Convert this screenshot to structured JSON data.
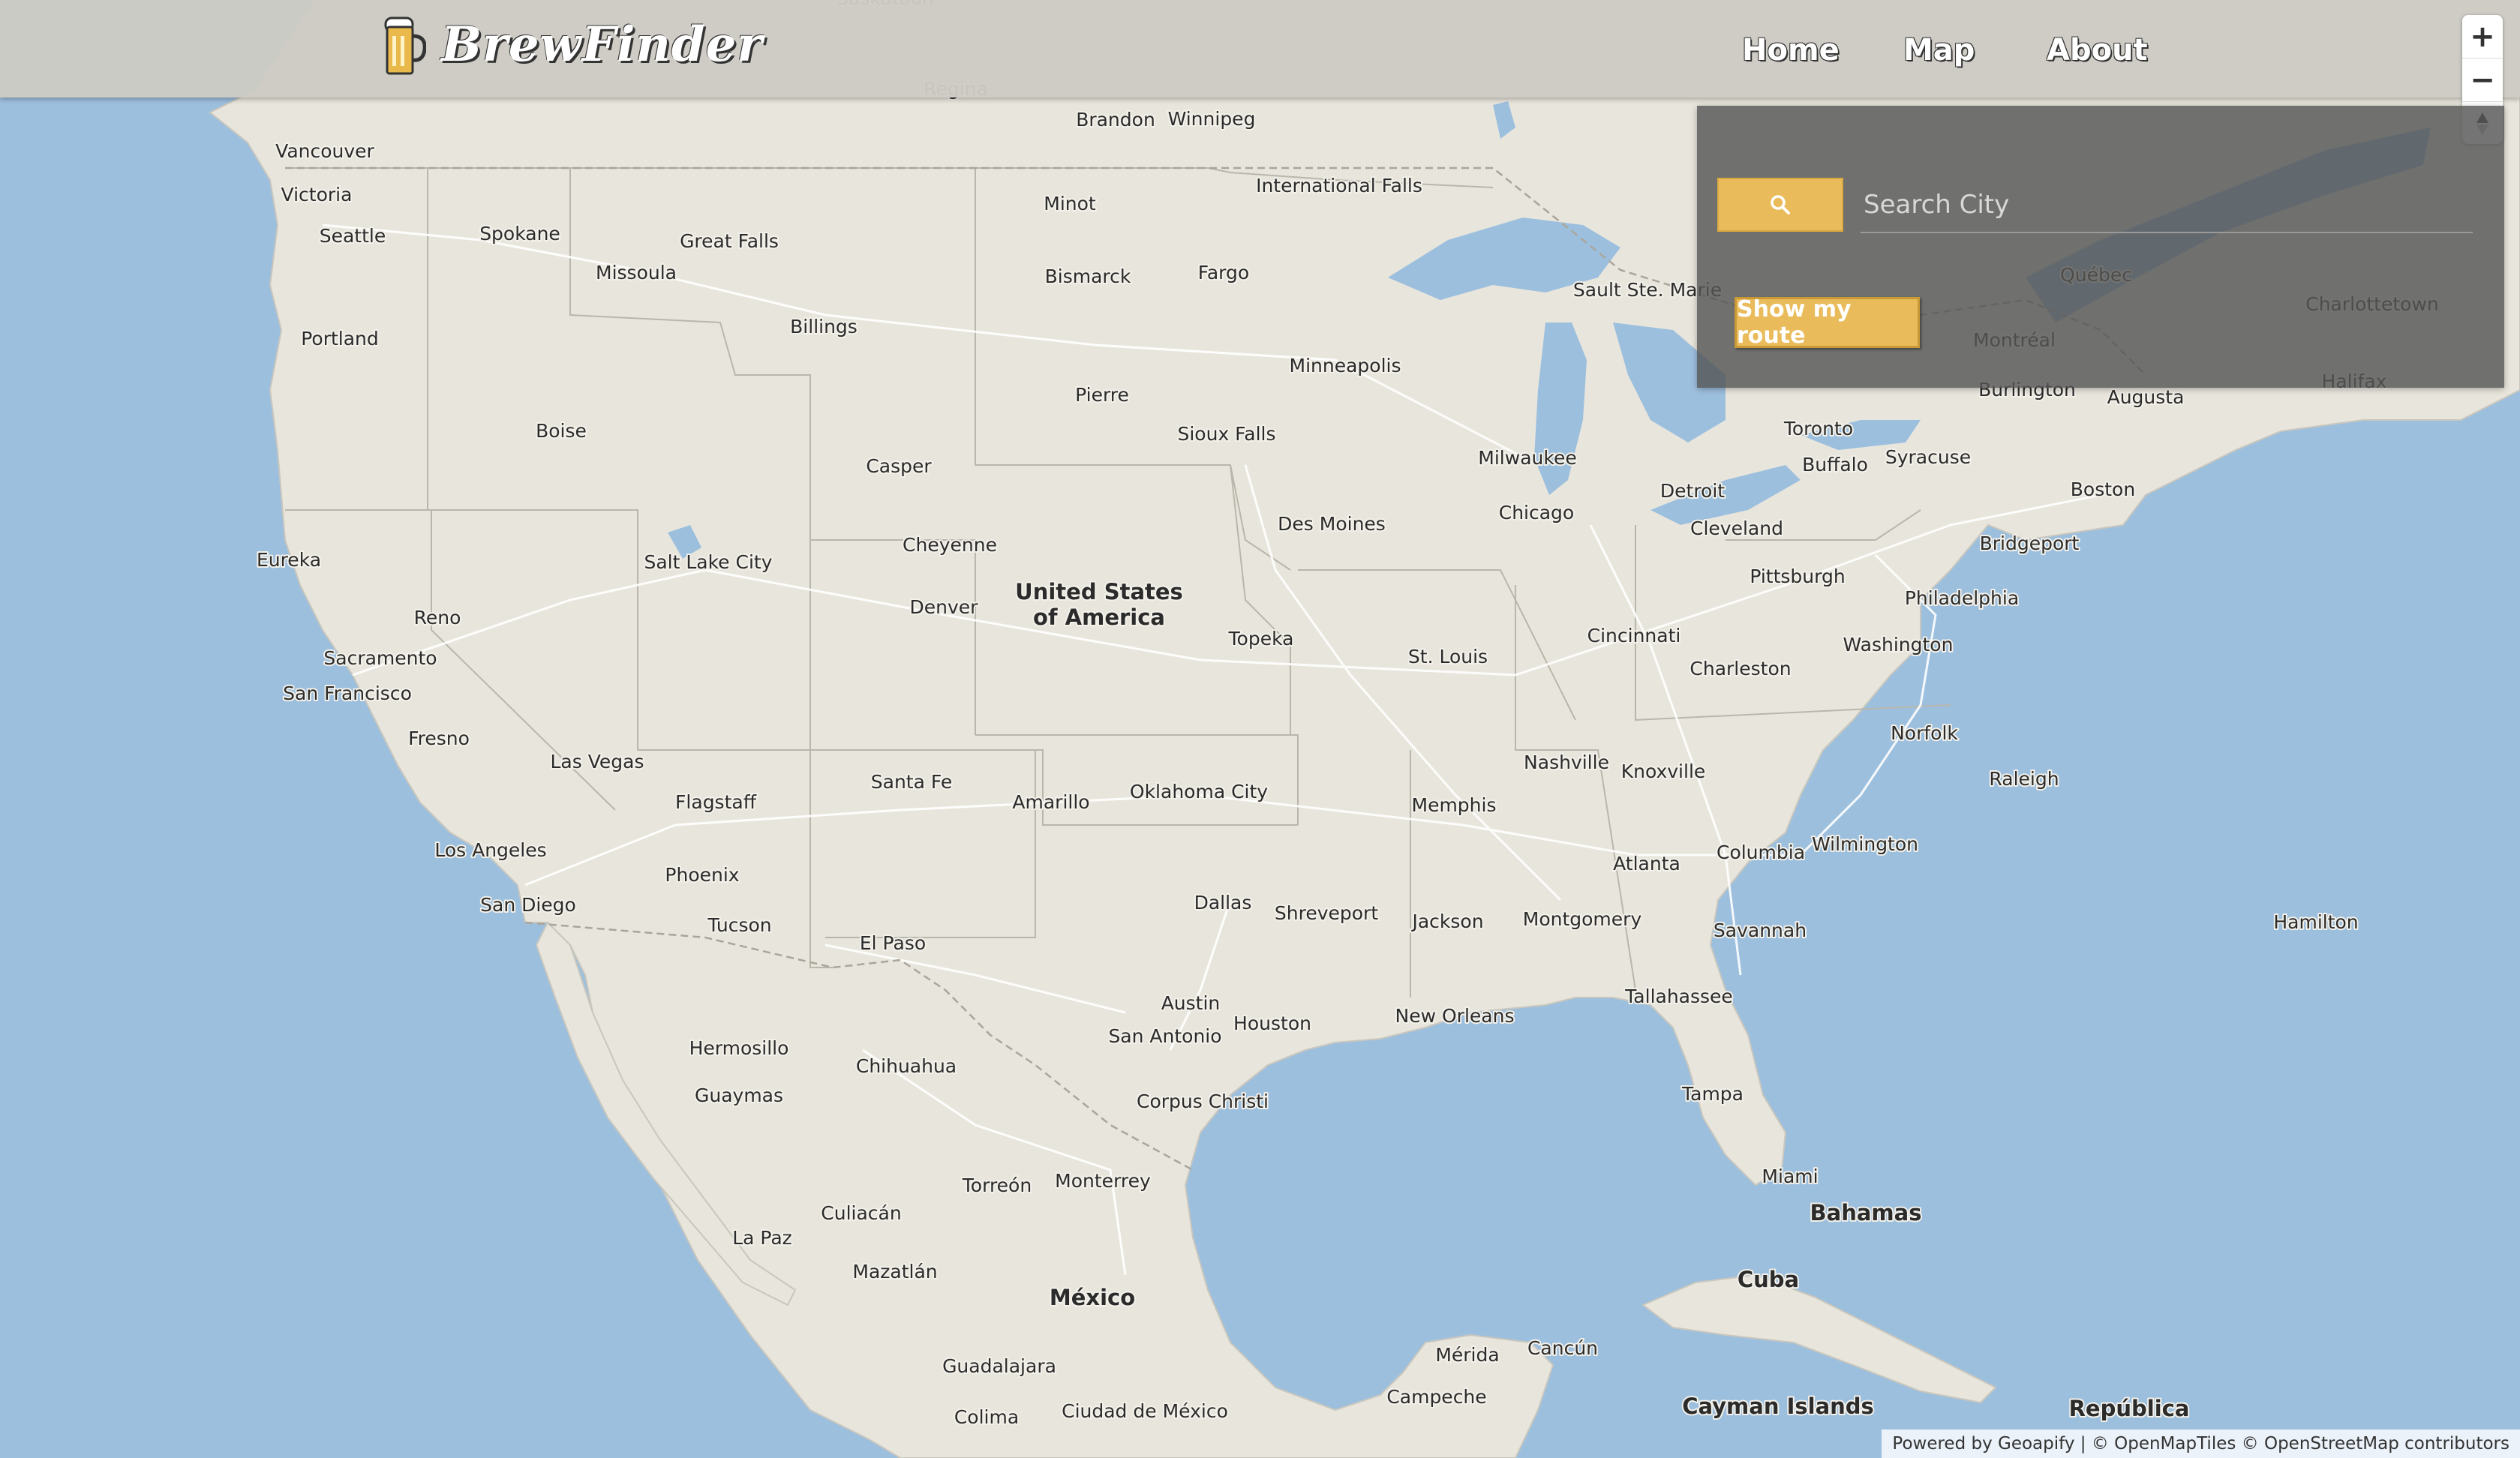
{
  "app": {
    "title": "BrewFinder",
    "logo_icon": "beer-mug-icon"
  },
  "nav": {
    "items": [
      {
        "label": "Home"
      },
      {
        "label": "Map"
      },
      {
        "label": "About"
      }
    ]
  },
  "zoom": {
    "zoom_in": "+",
    "zoom_out": "−",
    "reset_north": "compass-icon"
  },
  "search": {
    "placeholder": "Search City",
    "button_icon": "search-icon",
    "route_label": "Show my route"
  },
  "attribution": "Powered by Geoapify | © OpenMapTiles © OpenStreetMap contributors",
  "map": {
    "colors": {
      "land": "#e8e6dc",
      "water": "#9dbfde",
      "border": "#b3b3b3",
      "road": "#ffffff"
    },
    "labels": [
      {
        "text": "Saskatoon"
      },
      {
        "text": "Regina"
      },
      {
        "text": "Brandon"
      },
      {
        "text": "Winnipeg"
      },
      {
        "text": "Vancouver"
      },
      {
        "text": "Victoria"
      },
      {
        "text": "Seattle"
      },
      {
        "text": "Spokane"
      },
      {
        "text": "Great Falls"
      },
      {
        "text": "Missoula"
      },
      {
        "text": "Minot"
      },
      {
        "text": "International Falls"
      },
      {
        "text": "Bismarck"
      },
      {
        "text": "Fargo"
      },
      {
        "text": "Billings"
      },
      {
        "text": "Portland"
      },
      {
        "text": "Boise"
      },
      {
        "text": "Pierre"
      },
      {
        "text": "Minneapolis"
      },
      {
        "text": "Sioux Falls"
      },
      {
        "text": "Casper"
      },
      {
        "text": "Sault Ste. Marie"
      },
      {
        "text": "Québec"
      },
      {
        "text": "Charlottetown"
      },
      {
        "text": "Montréal"
      },
      {
        "text": "Burlington"
      },
      {
        "text": "Augusta"
      },
      {
        "text": "Halifax"
      },
      {
        "text": "Toronto"
      },
      {
        "text": "Buffalo"
      },
      {
        "text": "Syracuse"
      },
      {
        "text": "Milwaukee"
      },
      {
        "text": "Detroit"
      },
      {
        "text": "Boston"
      },
      {
        "text": "Chicago"
      },
      {
        "text": "Cleveland"
      },
      {
        "text": "Des Moines"
      },
      {
        "text": "Bridgeport"
      },
      {
        "text": "Eureka"
      },
      {
        "text": "Salt Lake City"
      },
      {
        "text": "Cheyenne"
      },
      {
        "text": "Pittsburgh"
      },
      {
        "text": "Philadelphia"
      },
      {
        "text": "Denver"
      },
      {
        "text": "United States"
      },
      {
        "text": "of America"
      },
      {
        "text": "Reno"
      },
      {
        "text": "Topeka"
      },
      {
        "text": "Cincinnati"
      },
      {
        "text": "Washington"
      },
      {
        "text": "Sacramento"
      },
      {
        "text": "St. Louis"
      },
      {
        "text": "Charleston"
      },
      {
        "text": "San Francisco"
      },
      {
        "text": "Fresno"
      },
      {
        "text": "Norfolk"
      },
      {
        "text": "Nashville"
      },
      {
        "text": "Las Vegas"
      },
      {
        "text": "Knoxville"
      },
      {
        "text": "Raleigh"
      },
      {
        "text": "Santa Fe"
      },
      {
        "text": "Oklahoma City"
      },
      {
        "text": "Flagstaff"
      },
      {
        "text": "Amarillo"
      },
      {
        "text": "Memphis"
      },
      {
        "text": "Los Angeles"
      },
      {
        "text": "Columbia"
      },
      {
        "text": "Wilmington"
      },
      {
        "text": "Atlanta"
      },
      {
        "text": "Phoenix"
      },
      {
        "text": "San Diego"
      },
      {
        "text": "Dallas"
      },
      {
        "text": "Shreveport"
      },
      {
        "text": "Jackson"
      },
      {
        "text": "Montgomery"
      },
      {
        "text": "Hamilton"
      },
      {
        "text": "Tucson"
      },
      {
        "text": "Savannah"
      },
      {
        "text": "El Paso"
      },
      {
        "text": "Tallahassee"
      },
      {
        "text": "Austin"
      },
      {
        "text": "New Orleans"
      },
      {
        "text": "Houston"
      },
      {
        "text": "San Antonio"
      },
      {
        "text": "Hermosillo"
      },
      {
        "text": "Chihuahua"
      },
      {
        "text": "Tampa"
      },
      {
        "text": "Guaymas"
      },
      {
        "text": "Corpus Christi"
      },
      {
        "text": "Miami"
      },
      {
        "text": "Torreón"
      },
      {
        "text": "Monterrey"
      },
      {
        "text": "Bahamas"
      },
      {
        "text": "Culiacán"
      },
      {
        "text": "La Paz"
      },
      {
        "text": "Cuba"
      },
      {
        "text": "Mazatlán"
      },
      {
        "text": "México"
      },
      {
        "text": "Mérida"
      },
      {
        "text": "Cancún"
      },
      {
        "text": "Guadalajara"
      },
      {
        "text": "Campeche"
      },
      {
        "text": "Cayman Islands"
      },
      {
        "text": "República"
      },
      {
        "text": "Colima"
      },
      {
        "text": "Ciudad de México"
      }
    ]
  }
}
